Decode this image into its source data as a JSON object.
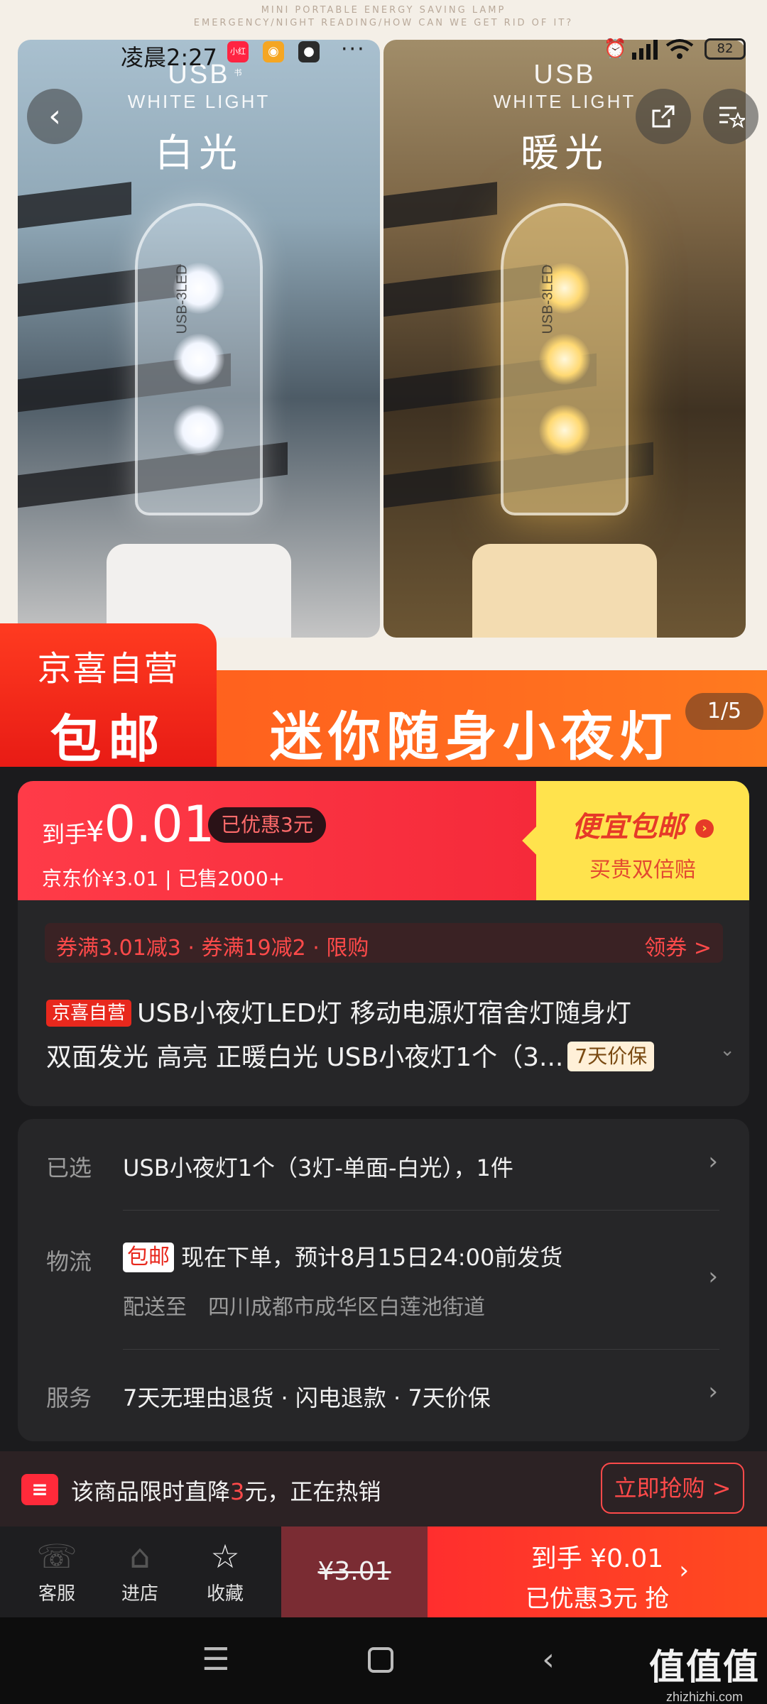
{
  "hero": {
    "tagline_line1": "MINI PORTABLE ENERGY SAVING LAMP",
    "tagline_line2": "EMERGENCY/NIGHT READING/HOW CAN WE GET RID OF IT?",
    "left_panel": {
      "title": "USB",
      "subtitle": "WHITE LIGHT",
      "label": "白光",
      "lamp_text": "USB-3LED"
    },
    "right_panel": {
      "title": "USB",
      "subtitle": "WHITE LIGHT",
      "label": "暖光",
      "lamp_text": "USB-3LED"
    },
    "badge_line1": "京喜自营",
    "badge_line2": "包邮",
    "slogan": "迷你随身小夜灯",
    "page_indicator": "1/5"
  },
  "status_bar": {
    "time": "凌晨2:27",
    "battery": "82",
    "app_chip_1": "小红书",
    "dots": "···"
  },
  "nav_icons": {
    "back": "back-icon",
    "share": "share-icon",
    "favorites_list": "favorites-list-icon"
  },
  "price": {
    "prefix": "到手",
    "currency": "¥",
    "value": "0.01",
    "saved": "已优惠3元",
    "jd_price": "京东价¥3.01",
    "sold": "已售2000+",
    "promo_title": "便宜包邮",
    "promo_sub": "买贵双倍赔"
  },
  "product": {
    "coupons": "券满3.01减3 · 券满19减2 · 限购",
    "coupon_action": "领券 >",
    "self_tag": "京喜自营",
    "title_line1": "USB小夜灯LED灯 移动电源灯宿舍灯随身灯",
    "title_line2": "双面发光 高亮 正暖白光 USB小夜灯1个（3...",
    "price_protect": "7天价保"
  },
  "spec": {
    "selected_label": "已选",
    "selected_value": "USB小夜灯1个（3灯-单面-白光），1件",
    "logistics_label": "物流",
    "free_tag": "包邮",
    "logistics_value": "现在下单，预计8月15日24:00前发货",
    "delivery_to": "配送至　四川成都市成华区白莲池街道",
    "service_label": "服务",
    "service_value": "7天无理由退货 · 闪电退款 · 7天价保"
  },
  "promo": {
    "text_a": "该商品限时直降",
    "text_num": "3",
    "text_b": "元，正在热销",
    "button": "立即抢购 >"
  },
  "actions": {
    "service": "客服",
    "store": "进店",
    "favorite": "收藏",
    "orig_price": "¥3.01",
    "buy_line1": "到手 ¥0.01",
    "buy_line2": "已优惠3元 抢"
  },
  "watermark": {
    "brand": "值值值",
    "url": "zhizhizhi.com"
  },
  "colors": {
    "brand_red": "#ff2a3a",
    "promo_yellow": "#ffe34d",
    "dark_card": "#262628",
    "strip_orange": "#ff6a1f"
  }
}
